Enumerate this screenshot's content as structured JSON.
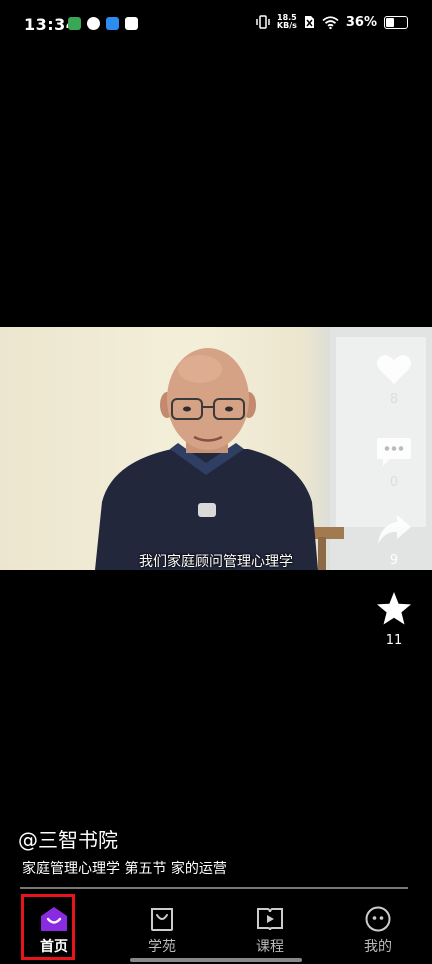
{
  "status": {
    "time": "13:34",
    "net_speed_value": "18.5",
    "net_speed_unit": "KB/s",
    "battery": "36%",
    "battery_level": 0.36,
    "icons": [
      "app-notify-icon",
      "chat-icon",
      "app-icon",
      "app2-icon",
      "vibrate-icon",
      "no-sim-icon",
      "wifi-icon",
      "battery-icon"
    ]
  },
  "video": {
    "subtitle": "我们家庭顾问管理心理学"
  },
  "actions": {
    "like_count": "8",
    "comment_count": "0",
    "share_count": "9",
    "favorite_count": "11"
  },
  "post": {
    "author": "@三智书院",
    "description": "家庭管理心理学 第五节 家的运营"
  },
  "tabs": [
    {
      "label": "首页",
      "icon": "home-icon",
      "active": true
    },
    {
      "label": "学苑",
      "icon": "shopping-bag-icon",
      "active": false
    },
    {
      "label": "课程",
      "icon": "play-book-icon",
      "active": false
    },
    {
      "label": "我的",
      "icon": "profile-face-icon",
      "active": false
    }
  ],
  "colors": {
    "accent_purple": "#8a2be2",
    "highlight_red": "#e8141c"
  }
}
